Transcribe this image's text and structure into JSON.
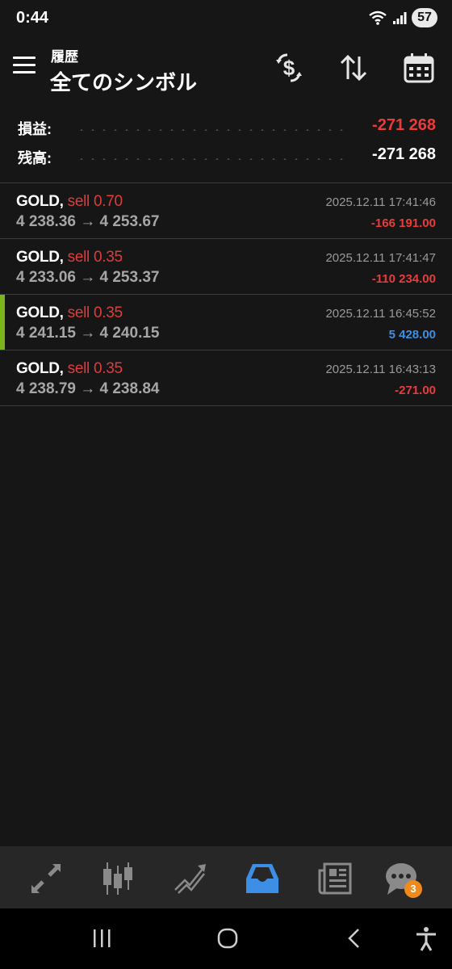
{
  "status_bar": {
    "time": "0:44",
    "battery": "57",
    "icons": [
      "wifi-icon",
      "signal-icon"
    ]
  },
  "header": {
    "subtitle": "履歴",
    "title": "全てのシンボル",
    "buttons": [
      "currency-exchange-icon",
      "sort-icon",
      "calendar-icon"
    ]
  },
  "summary": {
    "profit_label": "損益:",
    "profit_value": "-271 268",
    "balance_label": "残高:",
    "balance_value": "-271 268"
  },
  "trades": [
    {
      "symbol": "GOLD,",
      "side": "sell 0.70",
      "prices": "4 238.36 → 4 253.67",
      "time": "2025.12.11 17:41:46",
      "profit": "-166 191.00",
      "positive": false,
      "selected": false
    },
    {
      "symbol": "GOLD,",
      "side": "sell 0.35",
      "prices": "4 233.06 → 4 253.37",
      "time": "2025.12.11 17:41:47",
      "profit": "-110 234.00",
      "positive": false,
      "selected": false
    },
    {
      "symbol": "GOLD,",
      "side": "sell 0.35",
      "prices": "4 241.15 → 4 240.15",
      "time": "2025.12.11 16:45:52",
      "profit": "5 428.00",
      "positive": true,
      "selected": true
    },
    {
      "symbol": "GOLD,",
      "side": "sell 0.35",
      "prices": "4 238.79 → 4 238.84",
      "time": "2025.12.11 16:43:13",
      "profit": "-271.00",
      "positive": false,
      "selected": false
    }
  ],
  "tabbar": {
    "tabs": [
      "quotes-icon",
      "chart-icon",
      "trade-icon",
      "history-icon",
      "news-icon",
      "chat-icon"
    ],
    "active": "history-icon",
    "chat_badge": "3"
  },
  "colors": {
    "background": "#161616",
    "negative": "#ea3b3b",
    "positive": "#3d8fe6",
    "accent": "#7ab51d",
    "active_tab": "#3d8fe6",
    "badge": "#f08a1e"
  }
}
